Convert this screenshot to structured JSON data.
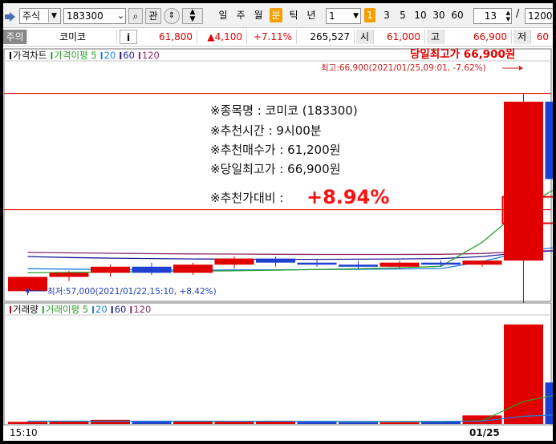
{
  "toolbar": {
    "market_select": "주식",
    "code_input": "183300",
    "search_button": "관",
    "periods": [
      "일",
      "주",
      "월",
      "분",
      "틱",
      "년"
    ],
    "selected_period": "분",
    "interval_select": "1",
    "minute_buttons": [
      "1",
      "3",
      "5",
      "10",
      "30",
      "60"
    ],
    "selected_minute": "1",
    "count_value": "13",
    "separator": "/",
    "total_value": "1200"
  },
  "quote": {
    "tag": "주의",
    "name": "코미코",
    "info_button": "i",
    "price": "61,800",
    "change": "▲4,100",
    "change_rate": "+7.11%",
    "volume": "265,527",
    "open_label": "시",
    "open_value": "61,000",
    "high_label": "고",
    "high_value": "66,900",
    "low_label": "저",
    "low_value": "60"
  },
  "colors": {
    "up": "#e00000",
    "down": "#1e3fcf",
    "ma5": "#2ea02e",
    "ma20": "#1e7fdf",
    "ma60": "#1c1c9a",
    "ma120": "#8a2a6a"
  },
  "chart_data": [
    {
      "type": "candlestick",
      "legend": [
        {
          "name": "가격차트",
          "color": "#000000"
        },
        {
          "name": "가격이평 5",
          "color": "#2ea02e"
        },
        {
          "name": "20",
          "color": "#1e7fdf"
        },
        {
          "name": "60",
          "color": "#1c1c9a"
        },
        {
          "name": "120",
          "color": "#8a2a6a"
        }
      ],
      "candles": [
        {
          "open": 57200,
          "high": 57900,
          "low": 57000,
          "close": 57900
        },
        {
          "open": 57900,
          "high": 58200,
          "low": 57700,
          "close": 58100
        },
        {
          "open": 58100,
          "high": 58500,
          "low": 57900,
          "close": 58400
        },
        {
          "open": 58400,
          "high": 58600,
          "low": 58000,
          "close": 58100
        },
        {
          "open": 58100,
          "high": 58600,
          "low": 58000,
          "close": 58500
        },
        {
          "open": 58500,
          "high": 58900,
          "low": 58300,
          "close": 58800
        },
        {
          "open": 58800,
          "high": 58900,
          "low": 58400,
          "close": 58600
        },
        {
          "open": 58600,
          "high": 58800,
          "low": 58400,
          "close": 58500
        },
        {
          "open": 58500,
          "high": 58700,
          "low": 58300,
          "close": 58400
        },
        {
          "open": 58400,
          "high": 58700,
          "low": 58300,
          "close": 58600
        },
        {
          "open": 58600,
          "high": 58700,
          "low": 58400,
          "close": 58500
        },
        {
          "open": 58500,
          "high": 58700,
          "low": 58400,
          "close": 58700
        },
        {
          "open": 58700,
          "high": 66900,
          "low": 58700,
          "close": 66500
        },
        {
          "open": 66500,
          "high": 66500,
          "low": 61800,
          "close": 62700
        }
      ],
      "ma5": [
        58100,
        58120,
        58140,
        58160,
        58180,
        58200,
        58230,
        58260,
        58300,
        58350,
        58420,
        59600,
        61300,
        62500
      ],
      "ma20": [
        58300,
        58280,
        58260,
        58240,
        58230,
        58240,
        58250,
        58260,
        58270,
        58290,
        58310,
        58650,
        59150,
        59400
      ],
      "ma60": [
        58900,
        58850,
        58820,
        58800,
        58780,
        58770,
        58760,
        58760,
        58770,
        58780,
        58800,
        58900,
        59100,
        59200
      ],
      "ma120": [
        59100,
        59080,
        59060,
        59040,
        59030,
        59020,
        59010,
        59000,
        59000,
        59000,
        59010,
        59050,
        59150,
        59200
      ],
      "ylim": [
        56700,
        68500
      ],
      "highlight_price": 61200,
      "high_note": "당일최고가 66,900원",
      "high_label": "최고:66,900(2021/01/25,09:01, -7.62%)",
      "low_label": "최저:57,000(2021/01/22,15:10, +8.42%)",
      "annotation": {
        "lines": [
          "※종목명 : 코미코 (183300)",
          "※추천시간 : 9시00분",
          "※추천매수가 : 61,200원",
          "※당일최고가 : 66,900원"
        ],
        "result_label": "※추천가대비 :",
        "result_value": "+8.94%"
      }
    },
    {
      "type": "bar",
      "legend": [
        {
          "name": "거래량",
          "color": "#e00000"
        },
        {
          "name": "거래이평 5",
          "color": "#2ea02e"
        },
        {
          "name": "20",
          "color": "#1e7fdf"
        },
        {
          "name": "60",
          "color": "#1c1c9a"
        },
        {
          "name": "120",
          "color": "#8a2a6a"
        }
      ],
      "values": [
        1800,
        2100,
        3500,
        2200,
        2000,
        1900,
        2600,
        1700,
        1500,
        1400,
        2300,
        7200,
        84000,
        35000
      ],
      "up": [
        true,
        true,
        true,
        false,
        true,
        true,
        true,
        false,
        false,
        true,
        false,
        true,
        true,
        false
      ],
      "ma5": [
        2200,
        2200,
        2300,
        2300,
        2300,
        2300,
        2400,
        2300,
        2100,
        1900,
        1900,
        2800,
        19000,
        26000
      ],
      "ma20": [
        2400,
        2400,
        2400,
        2400,
        2400,
        2300,
        2300,
        2300,
        2200,
        2200,
        2200,
        2500,
        6500,
        8000
      ],
      "ylim": [
        0,
        92000
      ],
      "x_labels": [
        "15:10",
        "01/25"
      ]
    }
  ]
}
